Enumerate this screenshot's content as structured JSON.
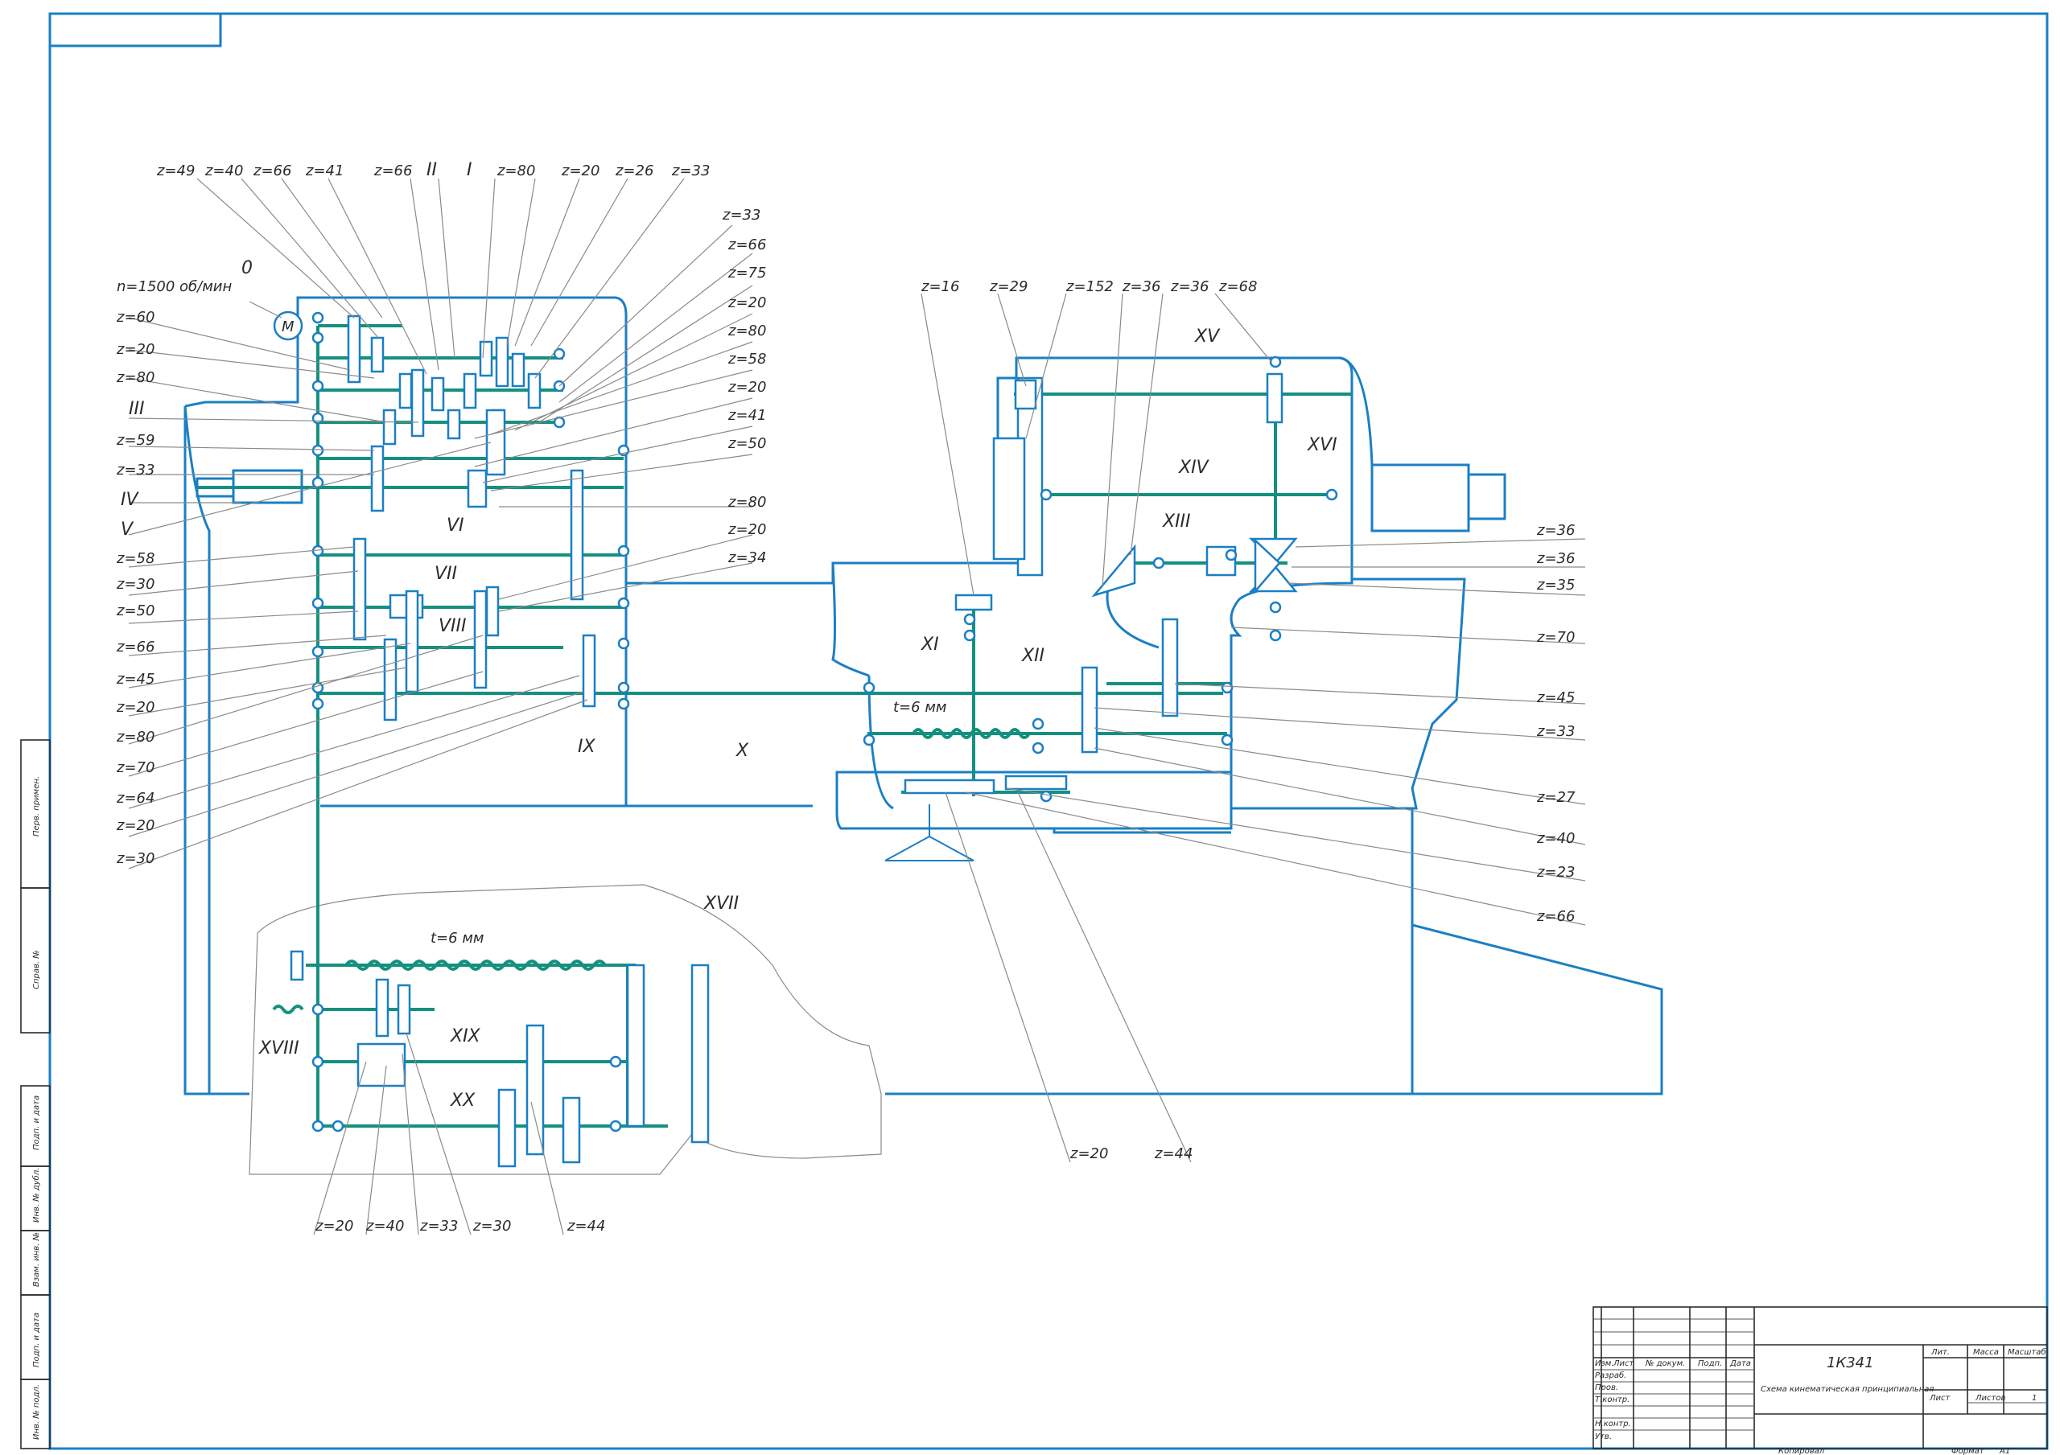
{
  "motor": {
    "label": "M",
    "speed": "n=1500 об/мин",
    "shaft0": "0"
  },
  "gear_labels_top": [
    "z=49",
    "z=40",
    "z=66",
    "z=41",
    "z=66",
    "II",
    "I",
    "z=80",
    "z=20",
    "z=26",
    "z=33"
  ],
  "gear_labels_right_of_box": [
    "z=33",
    "z=66",
    "z=75",
    "z=20",
    "z=80",
    "z=58",
    "z=20",
    "z=41",
    "z=50",
    "z=80",
    "z=20",
    "z=34"
  ],
  "gear_labels_left": [
    "z=60",
    "z=20",
    "z=80",
    "III",
    "z=59",
    "z=33",
    "IV",
    "V",
    "z=58",
    "z=30",
    "z=50",
    "z=66",
    "z=45",
    "z=20",
    "z=80",
    "z=70",
    "z=64",
    "z=20",
    "z=30"
  ],
  "shaft_labels_box": [
    "VI",
    "VII",
    "VIII",
    "IX",
    "X"
  ],
  "apron_labels_top": [
    "z=16",
    "z=29",
    "z=152",
    "z=36",
    "z=36",
    "z=68"
  ],
  "apron_shafts": [
    "XV",
    "XVI",
    "XIV",
    "XIII",
    "XI",
    "XII"
  ],
  "apron_labels_right": [
    "z=36",
    "z=36",
    "z=35",
    "z=70",
    "z=45",
    "z=33",
    "z=27",
    "z=40",
    "z=23",
    "z=66"
  ],
  "apron_labels_bottom": [
    "z=20",
    "z=44"
  ],
  "pitch_labels": [
    "t=6 мм",
    "t=6 мм"
  ],
  "bottom_box_labels": [
    "XVII",
    "XVIII",
    "XIX",
    "XX"
  ],
  "bottom_gear_labels": [
    "z=20",
    "z=40",
    "z=33",
    "z=30",
    "z=44"
  ],
  "side_stamp": [
    "Перв. примен.",
    "Справ. №",
    "Подп. и дата",
    "Инв. № дубл.",
    "Взам. инв. №",
    "Подп. и дата",
    "Инв. № подл."
  ],
  "title_block": {
    "designation": "1К341",
    "title": "Схема кинематическая принципиальная",
    "rows": [
      "Изм.",
      "Лист",
      "№ докум.",
      "Подп.",
      "Дата"
    ],
    "roles": [
      "Разраб.",
      "Пров.",
      "Т.контр.",
      "Н.контр.",
      "Утв."
    ],
    "cols": [
      "Лит.",
      "Масса",
      "Масштаб"
    ],
    "sheet": "Лист",
    "sheets": "Листов",
    "sheets_count": "1",
    "copied": "Копировал",
    "format": "Формат",
    "format_value": "А1"
  },
  "colors": {
    "frame": "#1a7fc4",
    "shaft": "#14907f",
    "leader": "#8a8a8a"
  }
}
